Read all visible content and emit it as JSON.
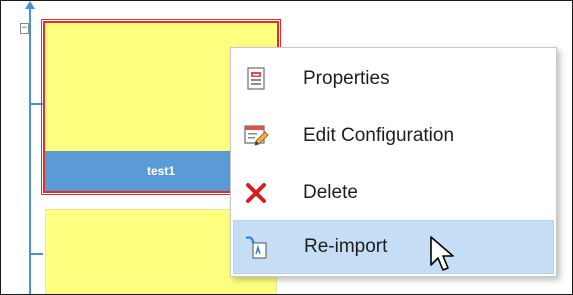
{
  "tree": {
    "toggle_glyph": "−",
    "items": [
      {
        "label": "test1",
        "selected": true,
        "fill_color": "#ffff7f",
        "label_bg": "#5b9bd5",
        "border_color": "#e82b2b"
      },
      {
        "label": "",
        "selected": false,
        "fill_color": "#ffff7f"
      }
    ]
  },
  "context_menu": {
    "items": [
      {
        "label": "Properties",
        "icon": "properties-icon",
        "highlighted": false
      },
      {
        "label": "Edit Configuration",
        "icon": "edit-configuration-icon",
        "highlighted": false
      },
      {
        "label": "Delete",
        "icon": "delete-x-icon",
        "highlighted": false
      },
      {
        "label": "Re-import",
        "icon": "reimport-icon",
        "highlighted": true
      }
    ],
    "highlight_color": "#c6def5"
  },
  "cursor": {
    "icon": "mouse-pointer-icon"
  }
}
